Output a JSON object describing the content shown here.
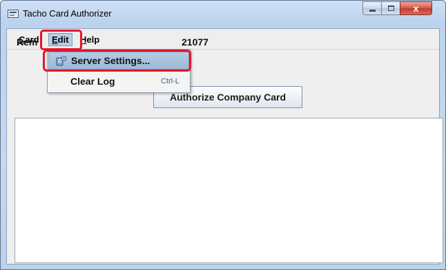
{
  "window": {
    "title": "Tacho Card Authorizer",
    "controls": {
      "minimize": "",
      "maximize": "",
      "close": "x"
    }
  },
  "menubar": {
    "items": [
      {
        "label": "Card",
        "mnemonic": "C"
      },
      {
        "label": "Edit",
        "mnemonic": "E"
      },
      {
        "label": "Help",
        "mnemonic": "H"
      }
    ]
  },
  "main": {
    "remote_label": "Rem",
    "remote_value": "21077",
    "authorize_button": "Authorize Company Card"
  },
  "edit_menu": {
    "items": [
      {
        "label": "Server Settings...",
        "icon": "server-settings-icon",
        "shortcut": ""
      },
      {
        "label": "Clear Log",
        "icon": "",
        "shortcut": "Ctrl-L"
      }
    ]
  },
  "colors": {
    "annotation": "#e3152a",
    "menu_highlight": "#b5cde6"
  }
}
